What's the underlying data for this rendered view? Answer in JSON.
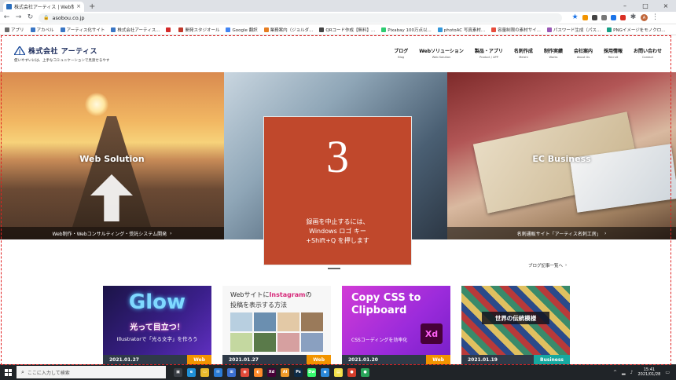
{
  "browser": {
    "tab_title": "株式会社アーティス | Web制作・システム開発",
    "url": "asobou.co.jp",
    "new_tab": "+",
    "tab_close": "×",
    "window_controls": {
      "minimize": "–",
      "maximize": "□",
      "close": "×"
    },
    "bookmarks": [
      {
        "label": "アプリ",
        "color": "#6b6b6b"
      },
      {
        "label": "アカペル",
        "color": "#3a76c4"
      },
      {
        "label": "アーティス化サイト",
        "color": "#3a76c4"
      },
      {
        "label": "株式会社アーティス...",
        "color": "#3a76c4"
      },
      {
        "label": "",
        "color": "#d42a2a"
      },
      {
        "label": "開発スタジオール",
        "color": "#c0392b"
      },
      {
        "label": "Google 翻訳",
        "color": "#4285f4"
      },
      {
        "label": "業務案内（ジョルダ...",
        "color": "#e67e22"
      },
      {
        "label": "QRコード作成【無料】...",
        "color": "#444444"
      },
      {
        "label": "Pixabay 100万点以...",
        "color": "#2ecc71"
      },
      {
        "label": "photoAC 写真素材...",
        "color": "#3498db"
      },
      {
        "label": "容量制限の素材サイ...",
        "color": "#e74c3c"
      },
      {
        "label": "パスワード生成（パス...",
        "color": "#9b59b6"
      },
      {
        "label": "PNGイメージをモノクロ...",
        "color": "#16a085"
      }
    ],
    "profile_initial": "A"
  },
  "site": {
    "logo_text": "株式会社 アーティス",
    "tagline": "使いやすいには、上手なコミュニケーションで見渡せるやす",
    "nav": [
      {
        "jp": "ブログ",
        "en": "Blog"
      },
      {
        "jp": "Webソリューション",
        "en": "Web Solution"
      },
      {
        "jp": "製品・アプリ",
        "en": "Product / APP"
      },
      {
        "jp": "名刺作成",
        "en": "Meishi"
      },
      {
        "jp": "制作実績",
        "en": "Works"
      },
      {
        "jp": "会社案内",
        "en": "About Us"
      },
      {
        "jp": "採用情報",
        "en": "Recruit"
      },
      {
        "jp": "お問い合わせ",
        "en": "Contact"
      }
    ],
    "hero": {
      "web": {
        "title": "Web Solution",
        "caption": "Web制作・Webコンサルティング・受託システム開発"
      },
      "ec": {
        "title": "EC Business",
        "caption": "名刺通販サイト「アーティス名刺工房」"
      }
    },
    "blog_more": "ブログ記事一覧へ",
    "blog_cards": [
      {
        "thumb_big": "Glow",
        "thumb_sub": "光って目立つ！",
        "thumb_sub2": "Illustratorで「光る文字」を作ろう",
        "date": "2021.01.27",
        "category": "Web",
        "cat_color": "#f29400"
      },
      {
        "thumb_line1_pre": "Webサイトに",
        "thumb_line1_em": "Instagram",
        "thumb_line1_post": "の",
        "thumb_line2": "投稿を表示する方法",
        "date": "2021.01.27",
        "category": "Web",
        "cat_color": "#f29400"
      },
      {
        "thumb_head": "Copy CSS to\nClipboard",
        "thumb_sub": "CSSコーディングを効率化",
        "thumb_badge": "Xd",
        "date": "2021.01.20",
        "category": "Web",
        "cat_color": "#f29400"
      },
      {
        "thumb_label": "世界の伝統模様",
        "date": "2021.01.19",
        "category": "Business",
        "cat_color": "#17a8a0"
      }
    ]
  },
  "recording_overlay": {
    "count": "3",
    "message": "録画を中止するには、\nWindows ロゴ キー\n+Shift+Q を押します"
  },
  "taskbar": {
    "search_placeholder": "ここに入力して検索",
    "apps": [
      {
        "name": "task-view",
        "color": "#3a3f46",
        "glyph": "▣"
      },
      {
        "name": "edge",
        "color": "#1f8fd6",
        "glyph": "e"
      },
      {
        "name": "file-explorer",
        "color": "#e8b92c",
        "glyph": "▭"
      },
      {
        "name": "mail",
        "color": "#2a7bd5",
        "glyph": "✉"
      },
      {
        "name": "store",
        "color": "#3a6fd0",
        "glyph": "⊞"
      },
      {
        "name": "chrome",
        "color": "#e04a3a",
        "glyph": "◉"
      },
      {
        "name": "firefox",
        "color": "#ff8a2a",
        "glyph": "◐"
      },
      {
        "name": "xd",
        "color": "#470137",
        "glyph": "Xd"
      },
      {
        "name": "illustrator",
        "color": "#f09a2a",
        "glyph": "Ai"
      },
      {
        "name": "photoshop",
        "color": "#0d2b47",
        "glyph": "Ps"
      },
      {
        "name": "dreamweaver",
        "color": "#35fa6e",
        "glyph": "Dw"
      },
      {
        "name": "vscode",
        "color": "#2b88d8",
        "glyph": "◆"
      },
      {
        "name": "sticky",
        "color": "#f3e04a",
        "glyph": "▤"
      },
      {
        "name": "app-red",
        "color": "#d43c2a",
        "glyph": "●"
      },
      {
        "name": "app-green",
        "color": "#2aa55a",
        "glyph": "●"
      }
    ],
    "time": "15:41",
    "date": "2021/01/28"
  }
}
